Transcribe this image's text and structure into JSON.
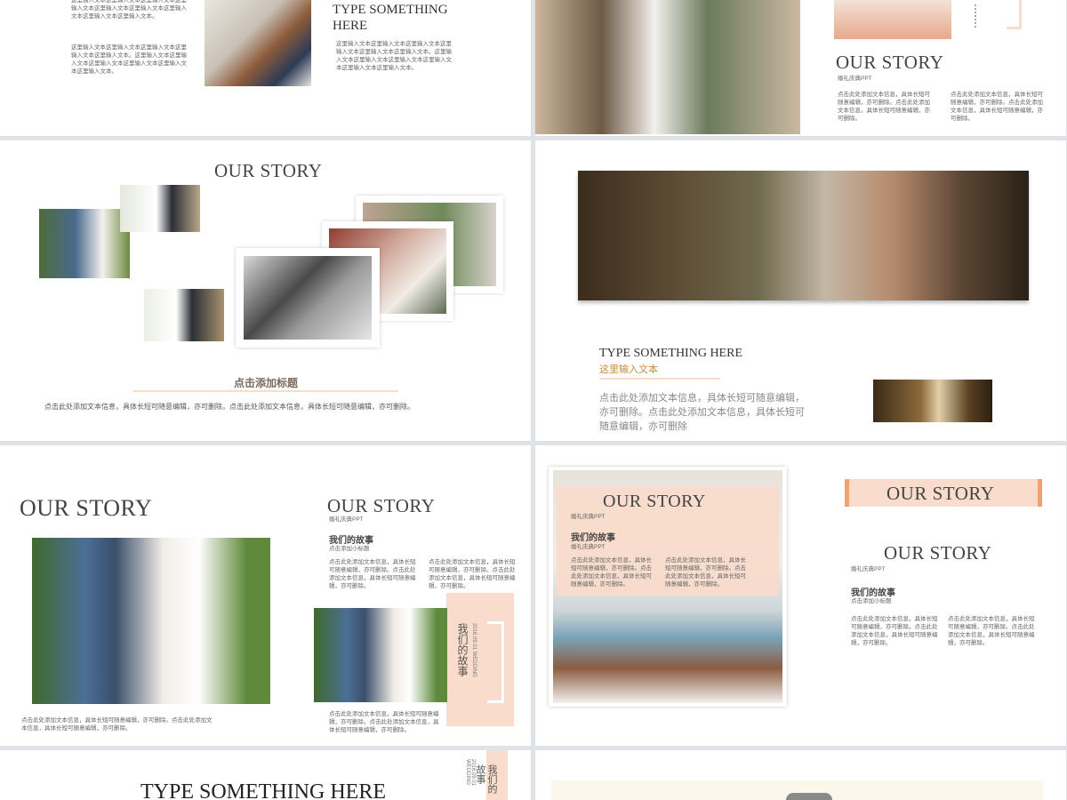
{
  "colors": {
    "peach": "#f9dccb",
    "accent": "#f4a06c",
    "gold": "#c98a3a",
    "text": "#555555",
    "title": "#444444"
  },
  "slide1": {
    "left_para_top": "这里输入文本这里输入文本这里输入文本这里输入文本这里输入文本这里输入文本这里输入文本这里输入文本这里输入文本。",
    "left_para_bottom": "这里输入文本这里输入文本这里输入文本这里输入文本这里输入文本。这里输入文本这里输入文本这里输入文本这里输入文本这里输入文本这里输入文本。",
    "title": "TYPE SOMETHING HERE",
    "right_para": "这里输入文本这里输入文本这里输入文本这里输入文本这里输入文本这里输入文本。这里输入文本这里输入文本这里输入文本这里输入文本这里输入文本这里输入文本。"
  },
  "slide2": {
    "title": "OUR STORY",
    "subtitle": "婚礼庆典PPT",
    "col1": "点击此处添加文本信息，具体长短可随意编辑，亦可删除。点击此处添加文本信息，具体长短可随意编辑，亦可删除。",
    "col2": "点击此处添加文本信息，具体长短可随意编辑，亦可删除。点击此处添加文本信息，具体长短可随意编辑，亦可删除。"
  },
  "slide3": {
    "title": "OUR STORY",
    "heading": "点击添加标题",
    "body": "点击此处添加文本信息，具体长短可随意编辑，亦可删除。点击此处添加文本信息，具体长短可随意编辑，亦可删除。"
  },
  "slide4": {
    "title": "TYPE SOMETHING HERE",
    "subtitle": "这里输入文本",
    "body": "点击此处添加文本信息，具体长短可随意编辑，亦可删除。点击此处添加文本信息，具体长短可随意编辑，亦可删除"
  },
  "slide5": {
    "title_left": "OUR STORY",
    "caption": "点击此处添加文本信息，具体长短可随意编辑，亦可删除。点击此处添加文本信息，具体长短可随意编辑，亦可删除。",
    "title_right": "OUR STORY",
    "subtitle": "婚礼庆典PPT",
    "heading": "我们的故事",
    "subheading": "点击添加小标题",
    "col1": "点击此处添加文本信息，具体长短可随意编辑，亦可删除。点击此处添加文本信息，具体长短可随意编辑，亦可删除。",
    "col2": "点击此处添加文本信息，具体长短可随意编辑，亦可删除。点击此处添加文本信息，具体长短可随意编辑，亦可删除。",
    "bottom_para": "点击此处添加文本信息，具体长短可随意编辑，亦可删除。点击此处添加文本信息，具体长短可随意编辑，亦可删除。",
    "vertical_cn": "我们的故事",
    "vertical_en": "2016.09.01 WEDDING"
  },
  "slide6": {
    "card_title": "OUR STORY",
    "card_subtitle": "婚礼庆典PPT",
    "card_heading": "我们的故事",
    "card_subheading": "婚礼庆典PPT",
    "card_col1": "点击此处添加文本信息，具体长短可随意编辑，亦可删除。点击此处添加文本信息，具体长短可随意编辑，亦可删除。",
    "card_col2": "点击此处添加文本信息，具体长短可随意编辑，亦可删除。点击此处添加文本信息，具体长短可随意编辑，亦可删除。",
    "banner_title": "OUR STORY",
    "title": "OUR STORY",
    "subtitle": "婚礼庆典PPT",
    "heading": "我们的故事",
    "subheading": "点击添加小标题",
    "col1": "点击此处添加文本信息，具体长短可随意编辑，亦可删除。点击此处添加文本信息，具体长短可随意编辑，亦可删除。",
    "col2": "点击此处添加文本信息，具体长短可随意编辑，亦可删除。点击此处添加文本信息，具体长短可随意编辑，亦可删除。"
  },
  "slide7": {
    "title": "TYPE SOMETHING HERE",
    "vertical_cn": "我们的故事",
    "vertical_en": "2016.09.01 WEDDING"
  }
}
